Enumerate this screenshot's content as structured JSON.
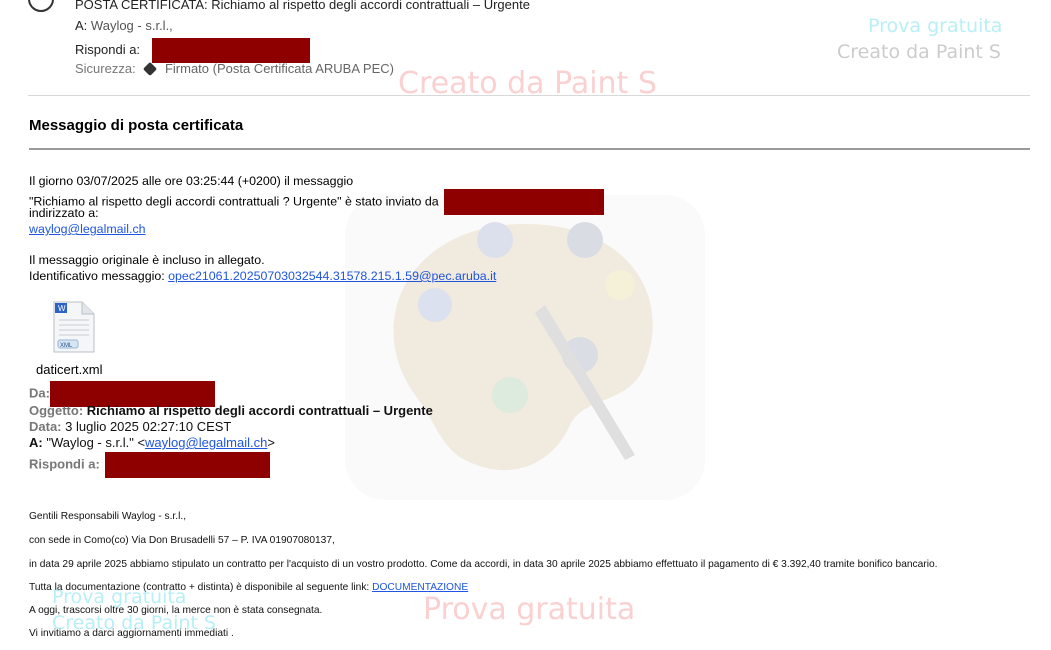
{
  "header": {
    "subject": "POSTA CERTIFICATA: Richiamo al rispetto degli accordi contrattuali – Urgente",
    "to_label": "A:",
    "to_value": "Waylog - s.r.l.,",
    "reply_to_label": "Rispondi a:",
    "security_label": "Sicurezza:",
    "security_value": "Firmato (Posta Certificata ARUBA PEC)"
  },
  "watermarks": {
    "trial_text": "Prova gratuita",
    "created_text": "Creato da Paint S"
  },
  "message": {
    "title": "Messaggio di posta certificata",
    "line1": "Il giorno 03/07/2025 alle ore 03:25:44 (+0200) il messaggio",
    "line2": "\"Richiamo al rispetto degli accordi contrattuali ? Urgente\" è stato inviato da",
    "line3": "indirizzato a:",
    "recipient_link": "waylog@legalmail.ch",
    "line4": "Il messaggio originale è incluso in allegato.",
    "id_label": "Identificativo messaggio:",
    "id_link": "opec21061.20250703032544.31578.215.1.59@pec.aruba.it"
  },
  "attachment": {
    "icon_label": "XML",
    "file_name": "daticert.xml"
  },
  "original_meta": {
    "from_label": "Da:",
    "subject_label": "Oggetto:",
    "subject_value": "Richiamo al rispetto degli accordi contrattuali – Urgente",
    "date_label": "Data:",
    "date_value": "3 luglio 2025 02:27:10 CEST",
    "to_label": "A:",
    "to_name": "\"Waylog - s.r.l.\" <",
    "to_link": "waylog@legalmail.ch",
    "to_close": ">",
    "reply_label": "Rispondi a:"
  },
  "body_text": {
    "greeting": "Gentili Responsabili  Waylog - s.r.l.,",
    "address": "con sede in Como(co) Via Don Brusadelli 57   – P. IVA  01907080137,",
    "contract": "in data 29 aprile 2025 abbiamo stipulato un contratto per l'acquisto di un vostro prodotto. Come da accordi, in data 30 aprile 2025 abbiamo effettuato il pagamento di € 3.392,40 tramite bonifico bancario.",
    "docs_prefix": "Tutta la documentazione (contratto + distinta) è disponibile al seguente link: ",
    "docs_link": "DOCUMENTAZIONE",
    "status": "A oggi, trascorsi oltre 30 giorni, la merce non è stata consegnata.",
    "request": "Vi  invitiamo a darci aggiornamenti immediati ."
  },
  "colors": {
    "redaction": "#8e0000",
    "link": "#1f55e0"
  }
}
